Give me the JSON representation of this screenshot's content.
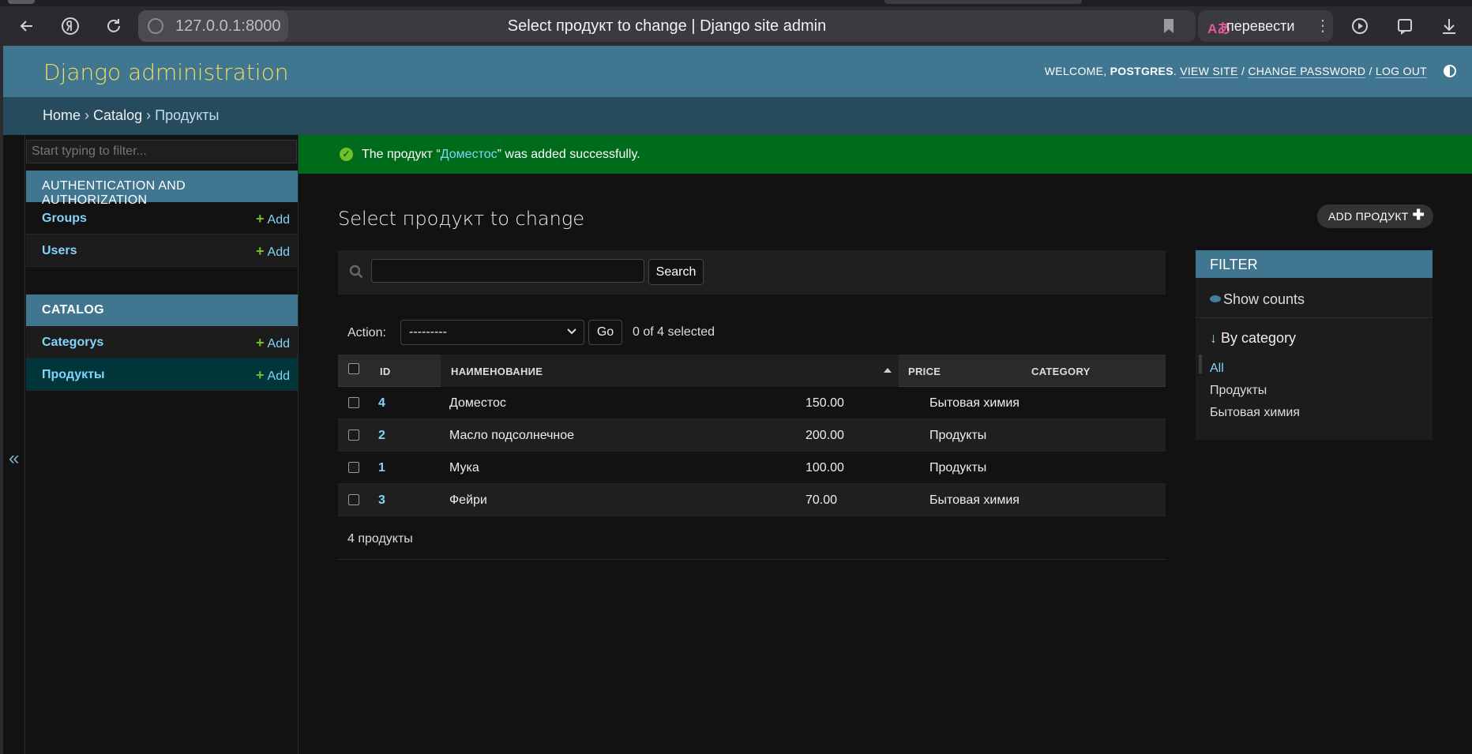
{
  "browser": {
    "url": "127.0.0.1:8000",
    "tab_title": "Select продукт to change | Django site admin",
    "translate_label": "перевести",
    "translate_icon_text": "Aあ"
  },
  "header": {
    "branding": "Django administration",
    "welcome": "WELCOME,",
    "username": "POSTGRES",
    "view_site": "VIEW SITE",
    "change_password": "CHANGE PASSWORD",
    "log_out": "LOG OUT",
    "sep": "/"
  },
  "breadcrumbs": {
    "home": "Home",
    "sep": "›",
    "catalog": "Catalog",
    "current": "Продукты"
  },
  "sidebar": {
    "filter_placeholder": "Start typing to filter...",
    "collapse_icon": "«",
    "apps": [
      {
        "caption": "AUTHENTICATION AND AUTHORIZATION",
        "models": [
          {
            "name": "Groups",
            "add": "Add"
          },
          {
            "name": "Users",
            "add": "Add"
          }
        ]
      },
      {
        "caption": "CATALOG",
        "models": [
          {
            "name": "Categorys",
            "add": "Add"
          },
          {
            "name": "Продукты",
            "add": "Add"
          }
        ]
      }
    ]
  },
  "message": {
    "prefix": "The продукт “",
    "link": "Доместос",
    "suffix": "” was added successfully.",
    "icon": "✓"
  },
  "content": {
    "title": "Select продукт to change",
    "add_button": "ADD ПРОДУКТ",
    "add_plus": "✚",
    "search_button": "Search",
    "action_label": "Action:",
    "action_value": "---------",
    "go_button": "Go",
    "selected_counter": "0 of 4 selected",
    "paginator": "4 продукты"
  },
  "table": {
    "headers": {
      "id": "ID",
      "name": "НАИМЕНОВАНИЕ",
      "price": "PRICE",
      "category": "CATEGORY"
    },
    "rows": [
      {
        "id": "4",
        "name": "Доместос",
        "price": "150.00",
        "category": "Бытовая химия"
      },
      {
        "id": "2",
        "name": "Масло подсолнечное",
        "price": "200.00",
        "category": "Продукты"
      },
      {
        "id": "1",
        "name": "Мука",
        "price": "100.00",
        "category": "Продукты"
      },
      {
        "id": "3",
        "name": "Фейри",
        "price": "70.00",
        "category": "Бытовая химия"
      }
    ]
  },
  "filter": {
    "heading": "FILTER",
    "show_counts": "Show counts",
    "by_title": "By category",
    "arrow": "↓",
    "options": [
      "All",
      "Продукты",
      "Бытовая химия"
    ],
    "selected": "All"
  },
  "colors": {
    "header_bg": "#417690",
    "branding": "#f5dd5d",
    "breadcrumb_bg": "#264b5d",
    "success_bg": "#006b1b",
    "link": "#81d4fa",
    "add_green": "#70bf2b"
  }
}
